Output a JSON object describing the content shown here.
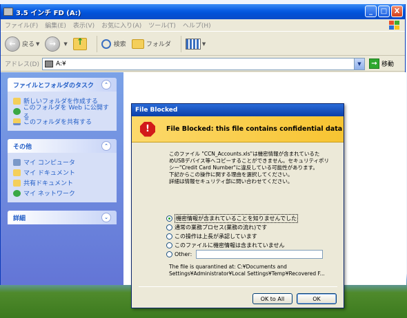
{
  "window": {
    "title": "3.5 インチ FD (A:)",
    "controls": [
      "_",
      "□",
      "X"
    ]
  },
  "menubar": {
    "items": [
      "ファイル(F)",
      "編集(E)",
      "表示(V)",
      "お気に入り(A)",
      "ツール(T)",
      "ヘルプ(H)"
    ]
  },
  "toolbar": {
    "back_label": "戻る",
    "search_label": "検索",
    "folders_label": "フォルダ"
  },
  "addressbar": {
    "label": "アドレス(D)",
    "value": "A:¥",
    "go_label": "移動"
  },
  "taskpane": {
    "file_tasks": {
      "title": "ファイルとフォルダのタスク",
      "items": [
        "新しいフォルダを作成する",
        "このフォルダを Web に公開する",
        "このフォルダを共有する"
      ]
    },
    "other_places": {
      "title": "その他",
      "items": [
        "マイ コンピュータ",
        "マイ ドキュメント",
        "共有ドキュメント",
        "マイ ネットワーク"
      ]
    },
    "details": {
      "title": "詳細"
    }
  },
  "dialog": {
    "title": "File Blocked",
    "banner": "File Blocked: this file contains confidential data",
    "message_lines": [
      "このファイル \"CCN_Accounts.xls\"は機密情報が含まれているた",
      "めUSBデバイス等へコピーすることができません。セキュリティポリ",
      "シー\"Credit Card Number\"に違反している可能性があります。",
      "下記からこの操作に関する理由を選択してください。",
      "詳細は情報セキュリティ部に問い合わせてください。"
    ],
    "options": [
      "機密情報が含まれていることを知りませんでした",
      "通常の業務プロセス(業務の流れ)です",
      "この操作は上長が承認しています",
      "このファイルに機密情報は含まれていません"
    ],
    "other_label": "Other:",
    "other_value": "",
    "quarantine_line1": "The file is quarantined at: C:¥Documents and",
    "quarantine_line2": "Settings¥Administrator¥Local Settings¥Temp¥Recovered F...",
    "ok_to_all_label": "OK to All",
    "ok_label": "OK"
  }
}
